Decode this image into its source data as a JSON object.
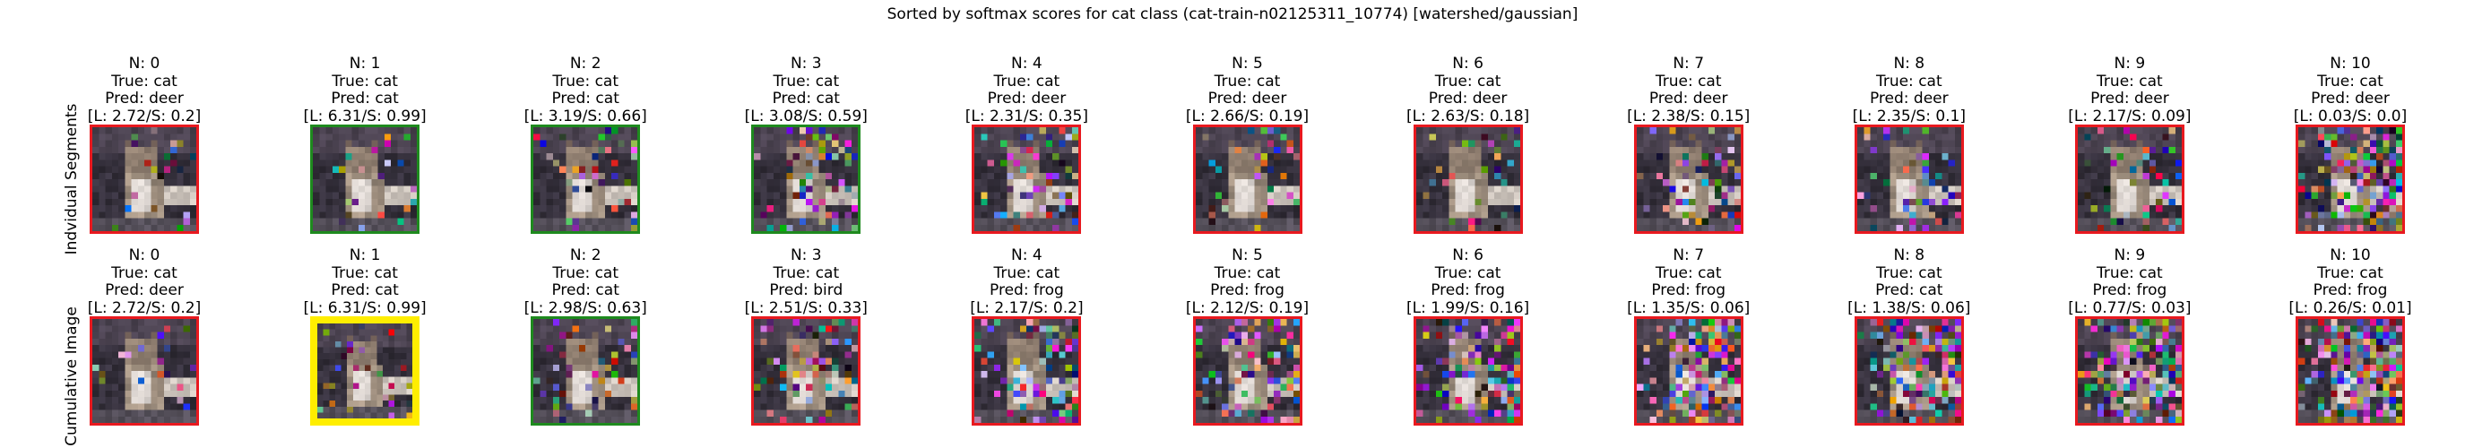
{
  "title": "Sorted by softmax scores for cat class (cat-train-n02125311_10774) [watershed/gaussian]",
  "rows": [
    {
      "label": "Indvidual Segments",
      "panels": [
        {
          "n": "N: 0",
          "true": "True: cat",
          "pred": "Pred: deer",
          "score": "[L: 2.72/S: 0.2]",
          "border": "red",
          "noise": 0.12
        },
        {
          "n": "N: 1",
          "true": "True: cat",
          "pred": "Pred: cat",
          "score": "[L: 6.31/S: 0.99]",
          "border": "green",
          "noise": 0.1
        },
        {
          "n": "N: 2",
          "true": "True: cat",
          "pred": "Pred: cat",
          "score": "[L: 3.19/S: 0.66]",
          "border": "green",
          "noise": 0.15
        },
        {
          "n": "N: 3",
          "true": "True: cat",
          "pred": "Pred: cat",
          "score": "[L: 3.08/S: 0.59]",
          "border": "green",
          "noise": 0.25
        },
        {
          "n": "N: 4",
          "true": "True: cat",
          "pred": "Pred: deer",
          "score": "[L: 2.31/S: 0.35]",
          "border": "red",
          "noise": 0.3
        },
        {
          "n": "N: 5",
          "true": "True: cat",
          "pred": "Pred: deer",
          "score": "[L: 2.66/S: 0.19]",
          "border": "red",
          "noise": 0.15
        },
        {
          "n": "N: 6",
          "true": "True: cat",
          "pred": "Pred: deer",
          "score": "[L: 2.63/S: 0.18]",
          "border": "red",
          "noise": 0.15
        },
        {
          "n": "N: 7",
          "true": "True: cat",
          "pred": "Pred: deer",
          "score": "[L: 2.38/S: 0.15]",
          "border": "red",
          "noise": 0.25
        },
        {
          "n": "N: 8",
          "true": "True: cat",
          "pred": "Pred: deer",
          "score": "[L: 2.35/S: 0.1]",
          "border": "red",
          "noise": 0.2
        },
        {
          "n": "N: 9",
          "true": "True: cat",
          "pred": "Pred: deer",
          "score": "[L: 2.17/S: 0.09]",
          "border": "red",
          "noise": 0.2
        },
        {
          "n": "N: 10",
          "true": "True: cat",
          "pred": "Pred: deer",
          "score": "[L: 0.03/S: 0.0]",
          "border": "red",
          "noise": 0.6
        }
      ]
    },
    {
      "label": "Cumulative Image",
      "panels": [
        {
          "n": "N: 0",
          "true": "True: cat",
          "pred": "Pred: deer",
          "score": "[L: 2.72/S: 0.2]",
          "border": "red",
          "noise": 0.12
        },
        {
          "n": "N: 1",
          "true": "True: cat",
          "pred": "Pred: cat",
          "score": "[L: 6.31/S: 0.99]",
          "border": "yellow",
          "noise": 0.1
        },
        {
          "n": "N: 2",
          "true": "True: cat",
          "pred": "Pred: cat",
          "score": "[L: 2.98/S: 0.63]",
          "border": "green",
          "noise": 0.2
        },
        {
          "n": "N: 3",
          "true": "True: cat",
          "pred": "Pred: bird",
          "score": "[L: 2.51/S: 0.33]",
          "border": "red",
          "noise": 0.3
        },
        {
          "n": "N: 4",
          "true": "True: cat",
          "pred": "Pred: frog",
          "score": "[L: 2.17/S: 0.2]",
          "border": "red",
          "noise": 0.35
        },
        {
          "n": "N: 5",
          "true": "True: cat",
          "pred": "Pred: frog",
          "score": "[L: 2.12/S: 0.19]",
          "border": "red",
          "noise": 0.4
        },
        {
          "n": "N: 6",
          "true": "True: cat",
          "pred": "Pred: frog",
          "score": "[L: 1.99/S: 0.16]",
          "border": "red",
          "noise": 0.45
        },
        {
          "n": "N: 7",
          "true": "True: cat",
          "pred": "Pred: frog",
          "score": "[L: 1.35/S: 0.06]",
          "border": "red",
          "noise": 0.5
        },
        {
          "n": "N: 8",
          "true": "True: cat",
          "pred": "Pred: cat",
          "score": "[L: 1.38/S: 0.06]",
          "border": "red",
          "noise": 0.55
        },
        {
          "n": "N: 9",
          "true": "True: cat",
          "pred": "Pred: frog",
          "score": "[L: 0.77/S: 0.03]",
          "border": "red",
          "noise": 0.6
        },
        {
          "n": "N: 10",
          "true": "True: cat",
          "pred": "Pred: frog",
          "score": "[L: 0.26/S: 0.01]",
          "border": "red",
          "noise": 0.7
        }
      ]
    }
  ],
  "colors": {
    "red": "#e8191f",
    "green": "#1e8a1e",
    "yellow": "#ffee00"
  },
  "thumbnail_icon": "cat-photo-thumbnail"
}
